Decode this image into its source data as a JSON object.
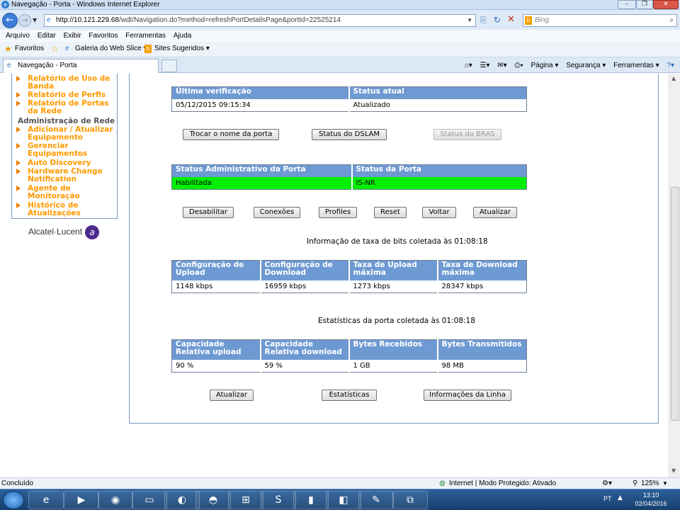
{
  "window": {
    "title": "Navegação - Porta - Windows Internet Explorer"
  },
  "toolbar": {
    "url_host": "http://10.121.229.68",
    "url_path": "/wdt/Navigation.do?method=refreshPortDetailsPage&portId=22525214",
    "search_placeholder": "Bing"
  },
  "menu": [
    "Arquivo",
    "Editar",
    "Exibir",
    "Favoritos",
    "Ferramentas",
    "Ajuda"
  ],
  "favorites": {
    "label": "Favoritos",
    "items": [
      "Galeria do Web Slice ▾",
      "Sites Sugeridos ▾"
    ]
  },
  "tab": {
    "title": "Navegação - Porta"
  },
  "command_bar": [
    "Página ▾",
    "Segurança ▾",
    "Ferramentas ▾"
  ],
  "sidebar": {
    "items_top": [
      "Relatório de Uso de Banda",
      "Relatório de Perfis",
      "Relatório de Portas da Rede"
    ],
    "section": "Administração de Rede",
    "items_bottom": [
      "Adicionar / Atualizar Equipamento",
      "Gerenciar Equipamentos",
      "Auto Discovery",
      "Hardware Change Notification",
      "Agente de Monitoração",
      "Histórico de Atualizações"
    ],
    "logo": "Alcatel·Lucent"
  },
  "verify_table": {
    "headers": [
      "Última verificação",
      "Status atual"
    ],
    "row": [
      "05/12/2015 09:15:34",
      "Atualizado"
    ]
  },
  "buttons_row1": [
    "Trocar o nome da porta",
    "Status do DSLAM",
    "Status do BRAS"
  ],
  "admin_table": {
    "headers": [
      "Status Administrativo da Porta",
      "Status da Porta"
    ],
    "row": [
      "Habilitada",
      "IS-NR"
    ]
  },
  "buttons_row2": [
    "Desabilitar",
    "Conexões",
    "Profiles",
    "Reset",
    "Voltar",
    "Atualizar"
  ],
  "bitrate_caption": "Informação de taxa de bits coletada às 01:08:18",
  "bitrate_table": {
    "headers": [
      "Configuração de Upload",
      "Configuração de Download",
      "Taxa de Upload máxima",
      "Taxa de Download máxima"
    ],
    "row": [
      "1148 kbps",
      "16959 kbps",
      "1273 kbps",
      "28347 kbps"
    ]
  },
  "stats_caption": "Estatísticas da porta coletada às 01:08:18",
  "stats_table": {
    "headers": [
      "Capacidade Relativa upload",
      "Capacidade Relativa download",
      "Bytes Recebidos",
      "Bytes Transmitidos"
    ],
    "row": [
      "90 %",
      "59 %",
      "1 GB",
      "98 MB"
    ]
  },
  "buttons_row3": [
    "Atualizar",
    "Estatísticas",
    "Informações da Linha"
  ],
  "status": {
    "left": "Concluído",
    "zone": "Internet | Modo Protegido: Ativado",
    "zoom": "125%"
  },
  "taskbar": {
    "lang": "PT",
    "time": "13:10",
    "date": "02/04/2016"
  }
}
